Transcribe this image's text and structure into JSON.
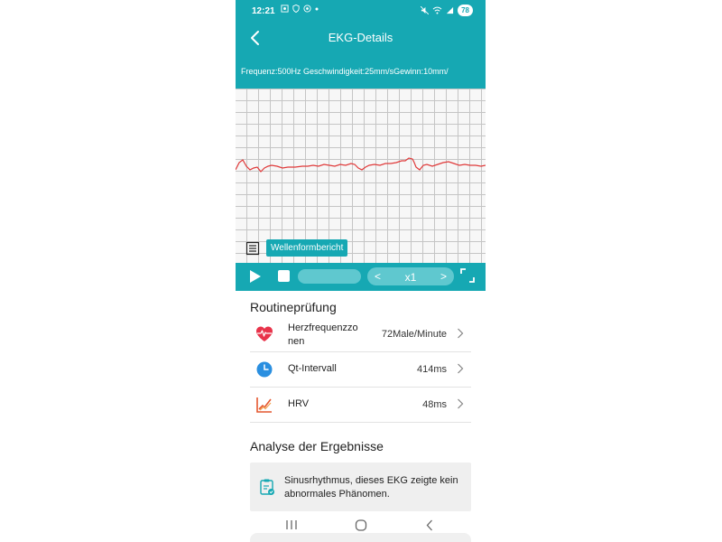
{
  "status_bar": {
    "time": "12:21",
    "battery": "78"
  },
  "app_bar": {
    "title": "EKG-Details"
  },
  "params": {
    "text": "Frequenz:500Hz Geschwindigkeit:25mm/sGewinn:10mm/"
  },
  "waveform": {
    "report_label": "Wellenformbericht",
    "trace_color": "#e03a3a"
  },
  "controls": {
    "speed": "x1",
    "prev": "<",
    "next": ">"
  },
  "routine": {
    "title": "Routineprüfung",
    "items": [
      {
        "label_line1": "Herzfrequenzzo",
        "label_line2": "nen",
        "value": "72Male/Minute",
        "icon": "heart-pulse-icon"
      },
      {
        "label_line1": "Qt-Intervall",
        "value": "414ms",
        "icon": "clock-icon"
      },
      {
        "label_line1": "HRV",
        "value": "48ms",
        "icon": "hrv-chart-icon"
      }
    ]
  },
  "analysis": {
    "title": "Analyse der Ergebnisse",
    "result": "Sinusrhythmus, dieses EKG zeigte kein abnormales Phänomen."
  },
  "colors": {
    "accent": "#16a8b3",
    "heart": "#e8334a",
    "clock": "#2a8fe0",
    "hrv": "#e4572e"
  }
}
